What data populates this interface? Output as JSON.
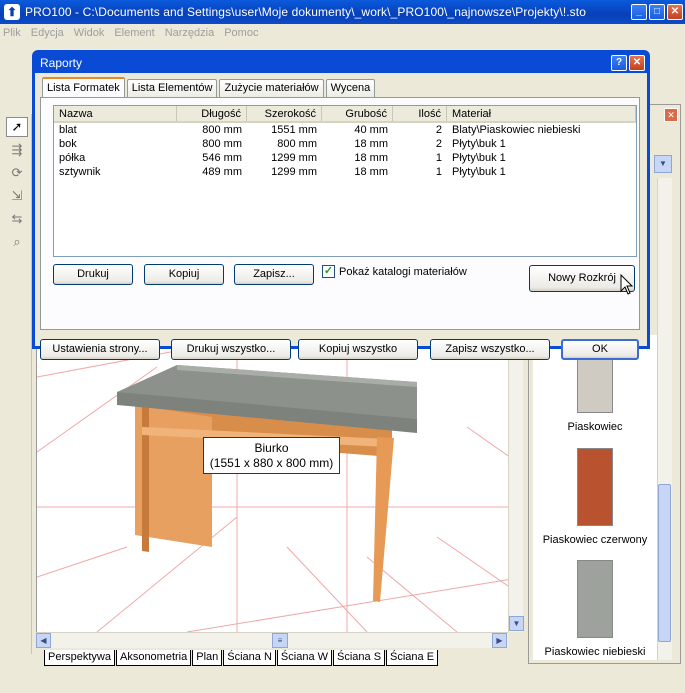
{
  "app": {
    "title": "PRO100 - C:\\Documents and Settings\\user\\Moje dokumenty\\_work\\_PRO100\\_najnowsze\\Projekty\\!.sto",
    "icon_letter": "⬆"
  },
  "window_controls": {
    "minimize": "_",
    "maximize": "□",
    "close": "✕"
  },
  "menu": [
    "Plik",
    "Edycja",
    "Widok",
    "Element",
    "Narzędzia",
    "Pomoc"
  ],
  "dialog": {
    "title": "Raporty",
    "help": "?",
    "close": "✕",
    "tabs": [
      "Lista Formatek",
      "Lista Elementów",
      "Zużycie materiałów",
      "Wycena"
    ],
    "active_tab": 0,
    "columns": [
      "Nazwa",
      "Długość",
      "Szerokość",
      "Grubość",
      "Ilość",
      "Materiał"
    ],
    "rows": [
      [
        "blat",
        "800 mm",
        "1551 mm",
        "40 mm",
        "2",
        "Blaty\\Piaskowiec niebieski"
      ],
      [
        "bok",
        "800 mm",
        "800 mm",
        "18 mm",
        "2",
        "Płyty\\buk 1"
      ],
      [
        "półka",
        "546 mm",
        "1299 mm",
        "18 mm",
        "1",
        "Płyty\\buk 1"
      ],
      [
        "sztywnik",
        "489 mm",
        "1299 mm",
        "18 mm",
        "1",
        "Płyty\\buk 1"
      ]
    ],
    "buttons": {
      "print": "Drukuj",
      "copy": "Kopiuj",
      "save": "Zapisz...",
      "show_catalogs": "Pokaż katalogi materiałów",
      "new_cutting": "Nowy Rozkrój",
      "page_setup": "Ustawienia strony...",
      "print_all": "Drukuj wszystko...",
      "copy_all": "Kopiuj wszystko",
      "save_all": "Zapisz wszystko...",
      "ok": "OK"
    },
    "show_catalogs_checked": true
  },
  "viewport": {
    "tooltip_title": "Biurko",
    "tooltip_dims": "(1551 x 880 x 800 mm)",
    "view_tabs": [
      "Perspektywa",
      "Aksonometria",
      "Plan",
      "Ściana N",
      "Ściana W",
      "Ściana S",
      "Ściana E"
    ],
    "active_view": 0
  },
  "materials": [
    {
      "name": "Piaskowiec",
      "color": "#cfcac2"
    },
    {
      "name": "Piaskowiec czerwony",
      "color": "#b9532f"
    },
    {
      "name": "Piaskowiec niebieski",
      "color": "#9da29c"
    }
  ]
}
